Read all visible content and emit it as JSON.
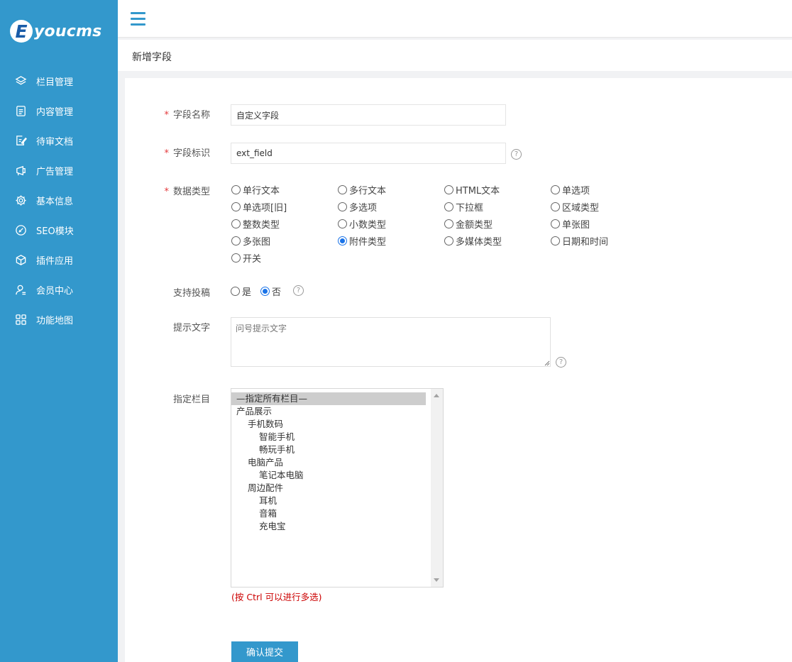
{
  "app": {
    "logo_letter": "E",
    "logo_text": "youcms"
  },
  "sidebar": {
    "items": [
      {
        "label": "栏目管理",
        "icon": "layers-icon"
      },
      {
        "label": "内容管理",
        "icon": "document-icon"
      },
      {
        "label": "待审文档",
        "icon": "edit-document-icon"
      },
      {
        "label": "广告管理",
        "icon": "ad-icon"
      },
      {
        "label": "基本信息",
        "icon": "gear-icon"
      },
      {
        "label": "SEO模块",
        "icon": "seo-icon"
      },
      {
        "label": "插件应用",
        "icon": "cube-icon"
      },
      {
        "label": "会员中心",
        "icon": "user-icon"
      },
      {
        "label": "功能地图",
        "icon": "grid-icon"
      }
    ]
  },
  "page": {
    "title": "新增字段"
  },
  "form": {
    "name": {
      "label": "字段名称",
      "value": "自定义字段"
    },
    "ident": {
      "label": "字段标识",
      "value": "ext_field"
    },
    "dtype": {
      "label": "数据类型",
      "options": [
        "单行文本",
        "多行文本",
        "HTML文本",
        "单选项",
        "单选项[旧]",
        "多选项",
        "下拉框",
        "区域类型",
        "整数类型",
        "小数类型",
        "金额类型",
        "单张图",
        "多张图",
        "附件类型",
        "多媒体类型",
        "日期和时间",
        "开关"
      ],
      "selected": "附件类型"
    },
    "submit_support": {
      "label": "支持投稿",
      "yes": "是",
      "no": "否",
      "selected": "否"
    },
    "tip": {
      "label": "提示文字",
      "placeholder": "问号提示文字"
    },
    "channel": {
      "label": "指定栏目",
      "options": [
        {
          "text": "—指定所有栏目—",
          "level": 0,
          "selected": true
        },
        {
          "text": "产品展示",
          "level": 0
        },
        {
          "text": "手机数码",
          "level": 1
        },
        {
          "text": "智能手机",
          "level": 2
        },
        {
          "text": "畅玩手机",
          "level": 2
        },
        {
          "text": "电脑产品",
          "level": 1
        },
        {
          "text": "笔记本电脑",
          "level": 2
        },
        {
          "text": "周边配件",
          "level": 1
        },
        {
          "text": "耳机",
          "level": 2
        },
        {
          "text": "音箱",
          "level": 2
        },
        {
          "text": "充电宝",
          "level": 2
        }
      ],
      "hint": "(按 Ctrl 可以进行多选)"
    },
    "submit_label": "确认提交"
  },
  "colors": {
    "sidebar": "#3398cc",
    "accent": "#3398cc",
    "required": "#e4393c",
    "hint": "#cc0000"
  }
}
